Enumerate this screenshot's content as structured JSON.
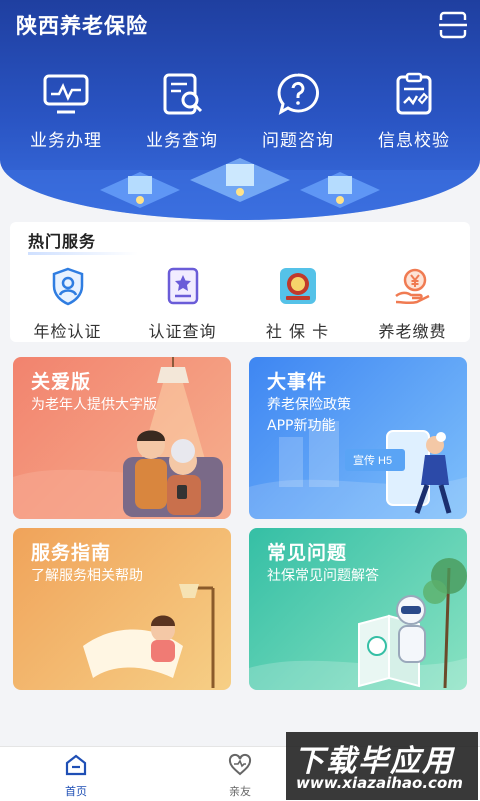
{
  "app": {
    "title": "陕西养老保险",
    "scan_icon": "scan-icon"
  },
  "quick_actions": [
    {
      "label": "业务办理",
      "icon": "monitor-chart-icon"
    },
    {
      "label": "业务查询",
      "icon": "document-search-icon"
    },
    {
      "label": "问题咨询",
      "icon": "question-bubble-icon"
    },
    {
      "label": "信息校验",
      "icon": "clipboard-check-icon"
    }
  ],
  "hot_services": {
    "title": "热门服务",
    "items": [
      {
        "label": "年检认证",
        "icon": "shield-user-icon"
      },
      {
        "label": "认证查询",
        "icon": "certificate-star-icon"
      },
      {
        "label": "社 保 卡",
        "icon": "social-security-card-icon"
      },
      {
        "label": "养老缴费",
        "icon": "hand-yuan-icon"
      }
    ]
  },
  "cards": [
    {
      "title": "关爱版",
      "subtitle": "为老年人提供大字版",
      "subtitle2": ""
    },
    {
      "title": "大事件",
      "subtitle": "养老保险政策",
      "subtitle2": "APP新功能",
      "badge": "宣传 H5"
    },
    {
      "title": "服务指南",
      "subtitle": "了解服务相关帮助",
      "subtitle2": ""
    },
    {
      "title": "常见问题",
      "subtitle": "社保常见问题解答",
      "subtitle2": ""
    }
  ],
  "tabbar": {
    "items": [
      {
        "label": "首页",
        "icon": "home-icon",
        "active": true
      },
      {
        "label": "亲友",
        "icon": "heart-icon",
        "active": false
      }
    ],
    "active_color": "#1f4fb5",
    "inactive_color": "#666666"
  },
  "watermark": {
    "line1": "下载毕应用",
    "line2": "www.xiazaihao.com"
  }
}
